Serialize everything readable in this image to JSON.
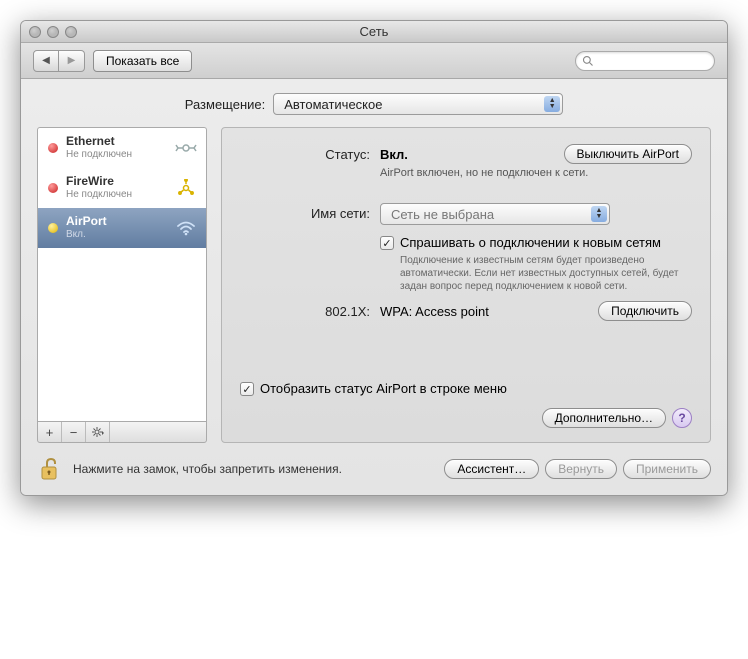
{
  "window": {
    "title": "Сеть"
  },
  "toolbar": {
    "show_all": "Показать все"
  },
  "location": {
    "label": "Размещение:",
    "value": "Автоматическое"
  },
  "sidebar": {
    "items": [
      {
        "name": "Ethernet",
        "status": "Не подключен",
        "dot": "red",
        "icon": "ethernet"
      },
      {
        "name": "FireWire",
        "status": "Не подключен",
        "dot": "red",
        "icon": "firewire"
      },
      {
        "name": "AirPort",
        "status": "Вкл.",
        "dot": "yellow",
        "icon": "wifi"
      }
    ]
  },
  "detail": {
    "status_label": "Статус:",
    "status_value": "Вкл.",
    "toggle_button": "Выключить AirPort",
    "status_sub": "AirPort включен, но не подключен к сети.",
    "network_label": "Имя сети:",
    "network_value": "Сеть не выбрана",
    "ask_join": "Спрашивать о подключении к новым сетям",
    "ask_help": "Подключение к известным сетям будет произведено автоматически. Если нет известных доступных сетей, будет задан вопрос перед подключением к новой сети.",
    "x8021_label": "802.1X:",
    "x8021_value": "WPA: Access point",
    "connect": "Подключить",
    "show_menu": "Отобразить статус AirPort в строке меню",
    "advanced": "Дополнительно…"
  },
  "footer": {
    "lock_text": "Нажмите на замок, чтобы запретить изменения.",
    "assistant": "Ассистент…",
    "revert": "Вернуть",
    "apply": "Применить"
  }
}
